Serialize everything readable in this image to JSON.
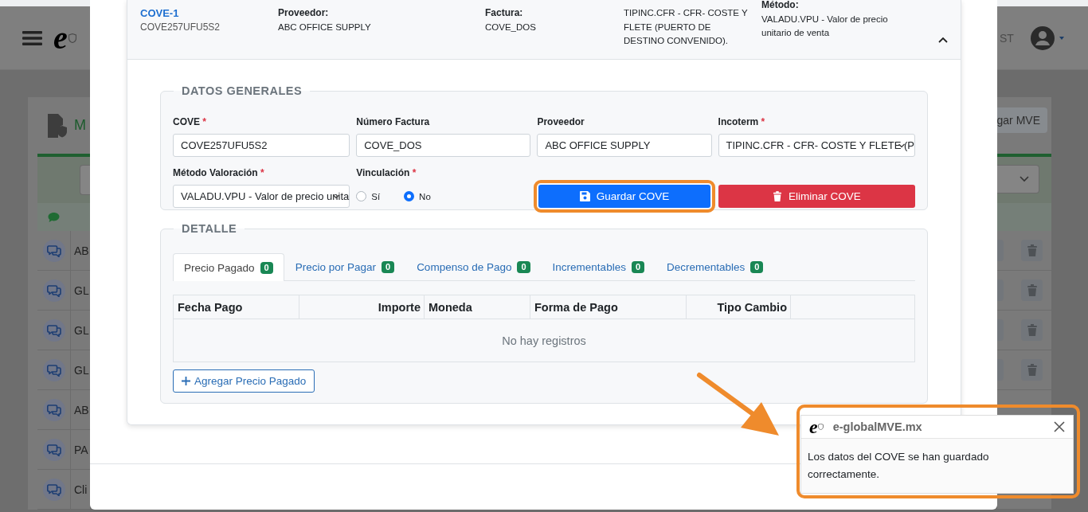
{
  "background": {
    "header": {
      "logo": "e",
      "user": "ST"
    },
    "card": {
      "title": "M",
      "button": "gar MVE"
    },
    "rows": [
      {
        "text": "AB"
      },
      {
        "text": "GL"
      },
      {
        "text": "GL"
      },
      {
        "text": "GL"
      },
      {
        "text": "AB"
      },
      {
        "text": "PA"
      },
      {
        "text": "Cli"
      }
    ]
  },
  "cove": {
    "title": "COVE-1",
    "code": "COVE257UFU5S2",
    "expanded": true,
    "summary": [
      {
        "label": "Proveedor:",
        "value": "ABC OFFICE SUPPLY"
      },
      {
        "label": "Factura:",
        "value": "COVE_DOS"
      },
      {
        "value": "TIPINC.CFR - CFR- COSTE Y FLETE (PUERTO DE DESTINO CONVENIDO)."
      },
      {
        "label": "Método:",
        "value": "VALADU.VPU - Valor de precio unitario de venta"
      }
    ]
  },
  "general": {
    "legend": "DATOS GENERALES",
    "fields": [
      {
        "label": "COVE",
        "mark": "*",
        "kind": "input",
        "value": "COVE257UFU5S2"
      },
      {
        "label": "Número Factura",
        "kind": "input",
        "value": "COVE_DOS"
      },
      {
        "label": "Proveedor",
        "kind": "input",
        "value": "ABC OFFICE SUPPLY"
      },
      {
        "label": "Incoterm",
        "mark": "*",
        "kind": "select",
        "value": "TIPINC.CFR - CFR- COSTE Y FLETE (P"
      },
      {
        "label": "Método Valoración",
        "mark": "*",
        "kind": "select",
        "value": "VALADU.VPU - Valor de precio unita"
      },
      {
        "label": "Vinculación",
        "mark": "*",
        "kind": "radio",
        "options": [
          {
            "label": "Sí",
            "selected": false
          },
          {
            "label": "No",
            "selected": true
          }
        ]
      }
    ],
    "buttons": [
      {
        "kind": "save",
        "label": "Guardar COVE",
        "highlighted": true
      },
      {
        "kind": "delete",
        "label": "Eliminar COVE",
        "highlighted": false
      }
    ]
  },
  "detail": {
    "legend": "DETALLE",
    "tabs": [
      {
        "label": "Precio Pagado",
        "count": "0",
        "selected": true
      },
      {
        "label": "Precio por Pagar",
        "count": "0",
        "selected": false
      },
      {
        "label": "Compenso de Pago",
        "count": "0",
        "selected": false
      },
      {
        "label": "Incrementables",
        "count": "0",
        "selected": false
      },
      {
        "label": "Decrementables",
        "count": "0",
        "selected": false
      }
    ],
    "columns": [
      {
        "label": "Fecha Pago",
        "kind": "text"
      },
      {
        "label": "Importe",
        "kind": "number"
      },
      {
        "label": "Moneda",
        "kind": "text"
      },
      {
        "label": "Forma de Pago",
        "kind": "text"
      },
      {
        "label": "Tipo Cambio",
        "kind": "number"
      }
    ],
    "empty": "No hay registros",
    "add_button": "Agregar Precio Pagado"
  },
  "toast": {
    "logo": "e",
    "title": "e-globalMVE.mx",
    "message": "Los datos del COVE se han guardado correctamente.",
    "highlighted": true
  }
}
